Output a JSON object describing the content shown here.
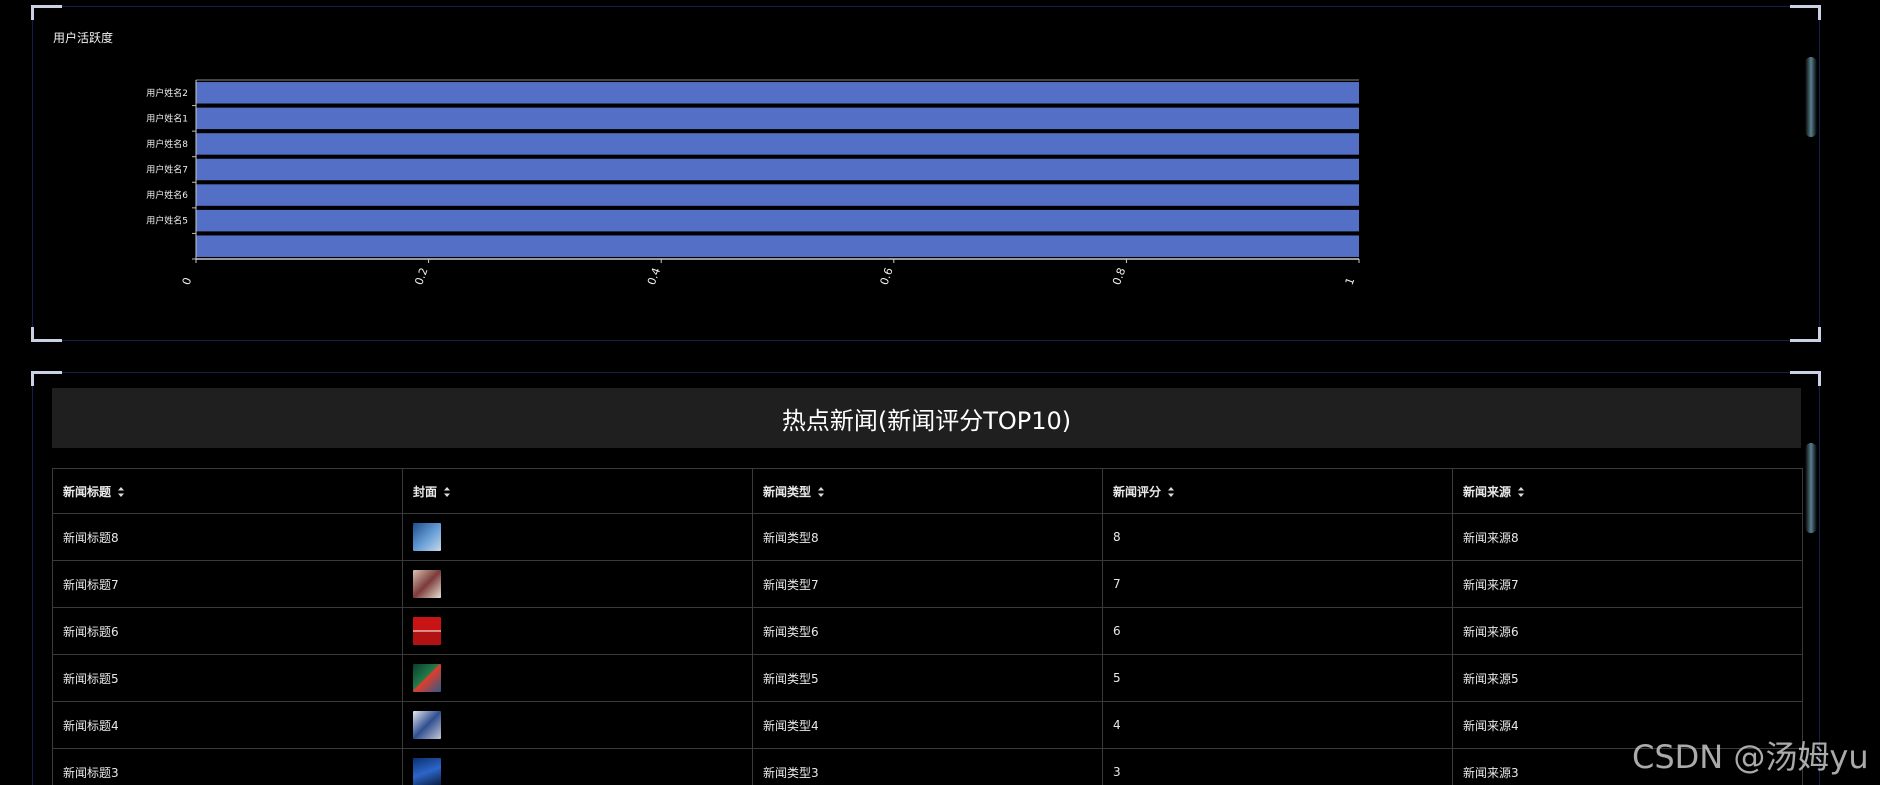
{
  "chart_panel": {
    "title": "用户活跃度"
  },
  "chart_data": {
    "type": "bar",
    "orientation": "horizontal",
    "categories": [
      "",
      "用户姓名5",
      "用户姓名6",
      "用户姓名7",
      "用户姓名8",
      "用户姓名1",
      "用户姓名2"
    ],
    "values": [
      1,
      1,
      1,
      1,
      1,
      1,
      1
    ],
    "xlim": [
      0,
      1
    ],
    "xticks": [
      "0",
      "0.2",
      "0.4",
      "0.6",
      "0.8",
      "1"
    ],
    "bar_color": "#5470c6",
    "grid": false
  },
  "news_panel": {
    "title": "热点新闻(新闻评分TOP10)",
    "columns": [
      "新闻标题",
      "封面",
      "新闻类型",
      "新闻评分",
      "新闻来源"
    ],
    "rows": [
      {
        "title": "新闻标题8",
        "cover": "cover-8",
        "type": "新闻类型8",
        "score": "8",
        "source": "新闻来源8"
      },
      {
        "title": "新闻标题7",
        "cover": "cover-7",
        "type": "新闻类型7",
        "score": "7",
        "source": "新闻来源7"
      },
      {
        "title": "新闻标题6",
        "cover": "cover-6",
        "type": "新闻类型6",
        "score": "6",
        "source": "新闻来源6"
      },
      {
        "title": "新闻标题5",
        "cover": "cover-5",
        "type": "新闻类型5",
        "score": "5",
        "source": "新闻来源5"
      },
      {
        "title": "新闻标题4",
        "cover": "cover-4",
        "type": "新闻类型4",
        "score": "4",
        "source": "新闻来源4"
      },
      {
        "title": "新闻标题3",
        "cover": "cover-3",
        "type": "新闻类型3",
        "score": "3",
        "source": "新闻来源3"
      }
    ]
  },
  "watermark": "CSDN @汤姆yu",
  "colors": {
    "background": "#000000",
    "panel_border": "#0f2149",
    "corner": "#c9d2e2",
    "bar": "#5470c6",
    "table_header_bg": "#1f1f1f"
  }
}
